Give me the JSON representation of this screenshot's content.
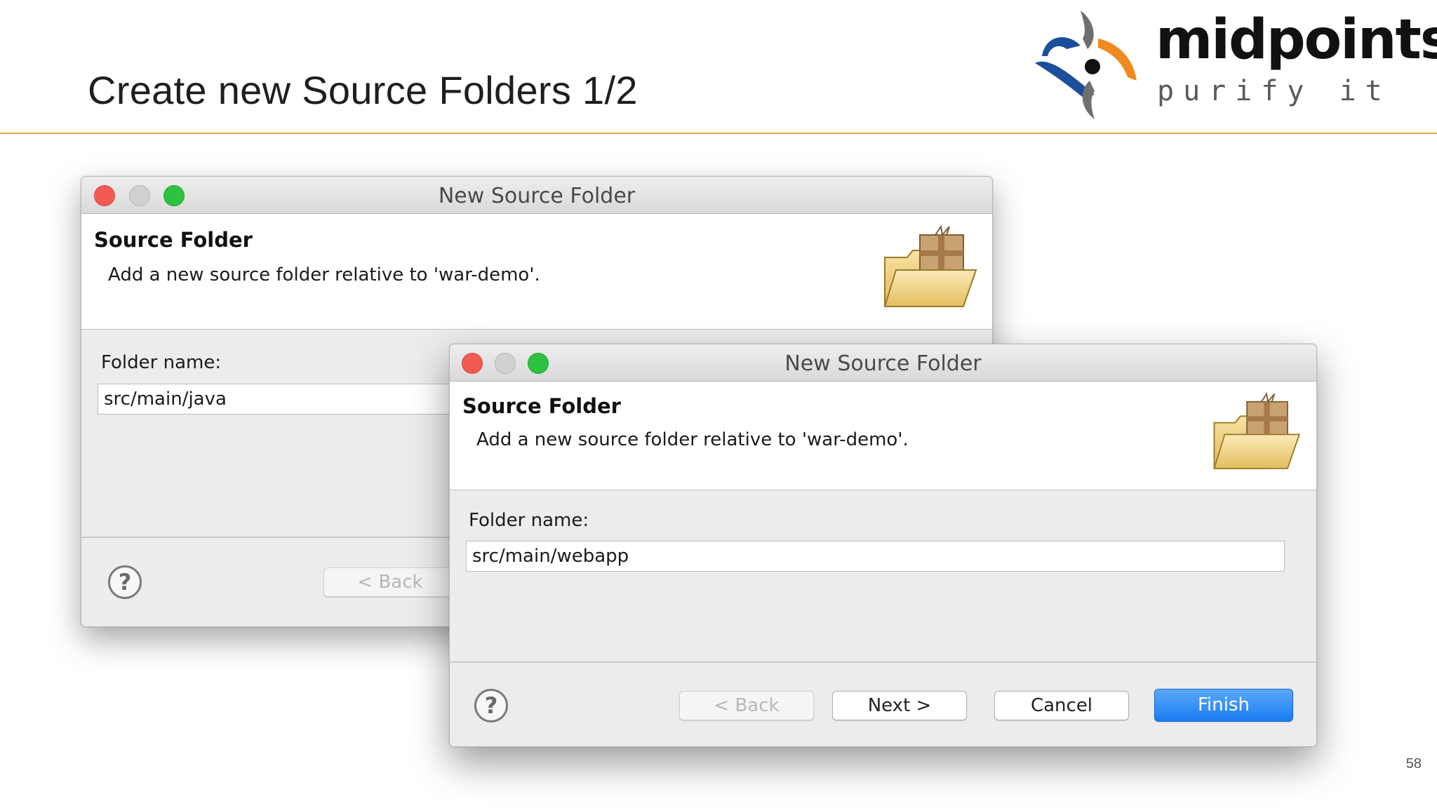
{
  "slide": {
    "title": "Create new Source Folders  1/2",
    "page_number": "58",
    "accent_color": "#e8a93b"
  },
  "logo": {
    "name": "midpoints",
    "tagline": "purify it"
  },
  "dialog_back": {
    "window_title": "New Source Folder",
    "header_title": "Source Folder",
    "header_description": "Add a new source folder relative to 'war-demo'.",
    "folder_label": "Folder name:",
    "folder_value": "src/main/java",
    "back_label": "< Back",
    "help_icon": "question-mark-icon",
    "header_icon": "source-folder-package-icon"
  },
  "dialog_front": {
    "window_title": "New Source Folder",
    "header_title": "Source Folder",
    "header_description": "Add a new source folder relative to 'war-demo'.",
    "folder_label": "Folder name:",
    "folder_value": "src/main/webapp",
    "buttons": {
      "back": "< Back",
      "next": "Next >",
      "cancel": "Cancel",
      "finish": "Finish"
    },
    "help_icon": "question-mark-icon",
    "header_icon": "source-folder-package-icon",
    "finish_color": "#1a7cf2"
  }
}
